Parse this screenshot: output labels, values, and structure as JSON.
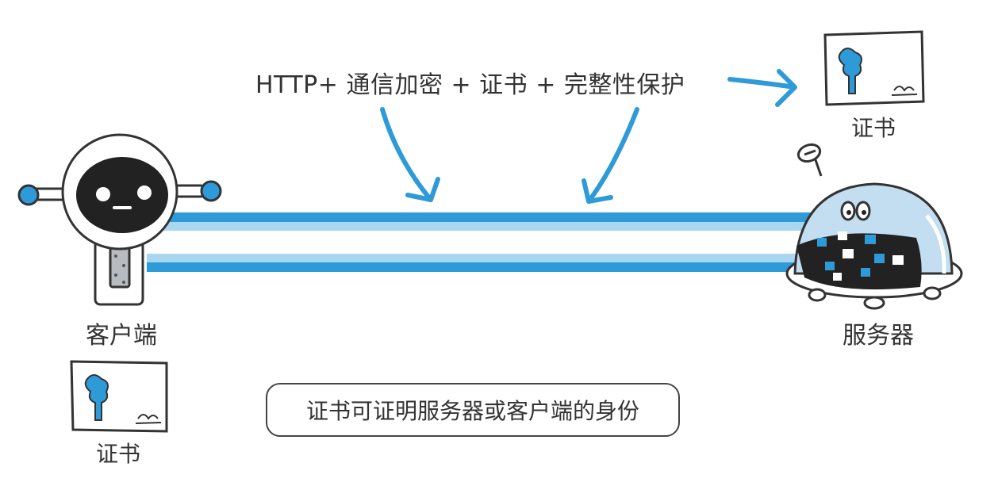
{
  "headline": "HTTP+ 通信加密 + 证书 + 完整性保护",
  "client": {
    "label": "客户端"
  },
  "server": {
    "label": "服务器"
  },
  "certificates": {
    "top_label": "证书",
    "bottom_label": "证书"
  },
  "note": "证书可证明服务器或客户端的身份",
  "colors": {
    "accent_blue": "#2e9ad8",
    "light_blue": "#a9d7f2",
    "outline": "#333333",
    "robot_face": "#222222"
  }
}
